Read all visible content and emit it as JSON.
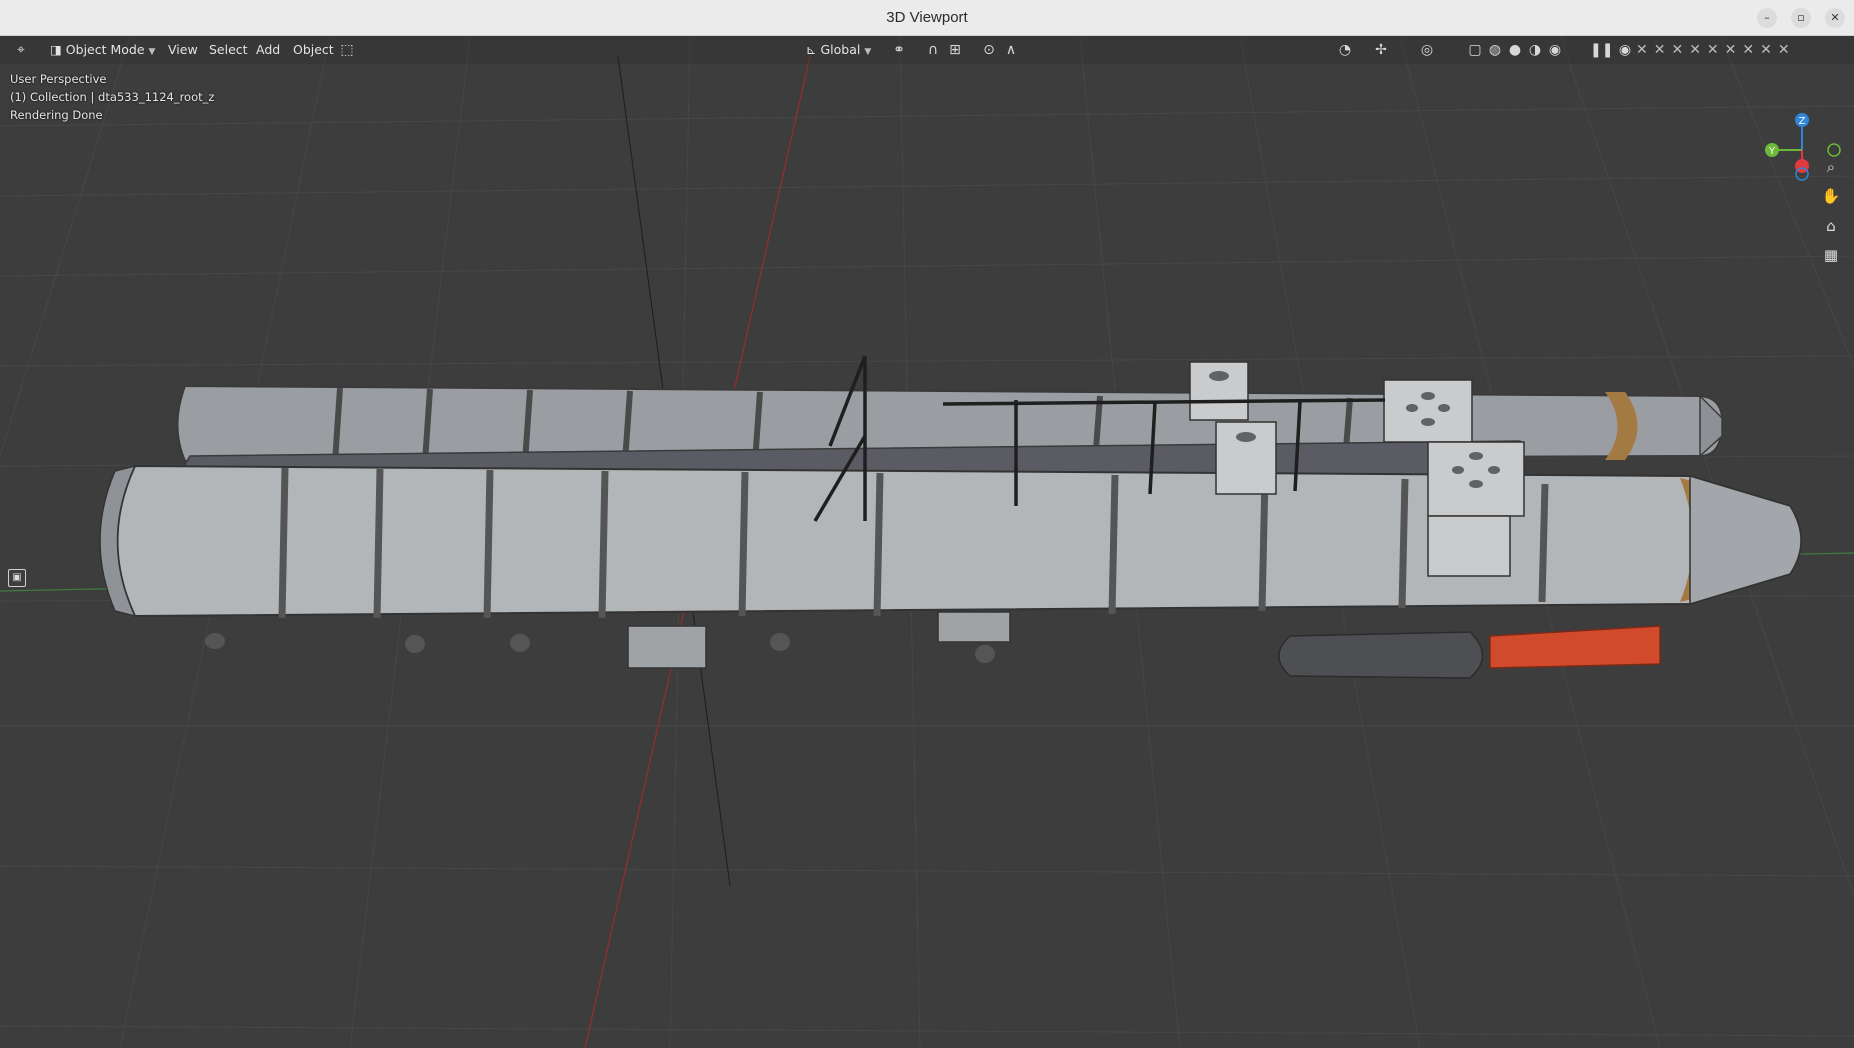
{
  "window": {
    "title": "3D Viewport",
    "controls": [
      "minimize-icon",
      "restore-icon",
      "close-icon"
    ]
  },
  "header": {
    "editor_type_icon": "editor-type-icon",
    "mode": "Object Mode",
    "menus": [
      "View",
      "Select",
      "Add",
      "Object"
    ],
    "transform_orientation": "Global",
    "icons": [
      "select-box-icon",
      "pivot-icon",
      "snap-icon",
      "snap-target-icon",
      "proportional-edit-icon",
      "falloff-icon",
      "visibility-icon",
      "gizmo-icon",
      "overlay-icon",
      "xray-icon",
      "wireframe-shading-icon",
      "solid-shading-icon",
      "material-shading-icon",
      "rendered-shading-icon",
      "pause-icon"
    ]
  },
  "overlay": {
    "perspective": "User Perspective",
    "collection": "(1) Collection | dta533_1124_root_z",
    "status": "Rendering Done"
  },
  "gizmo": {
    "z_label": "Z",
    "y_label": "Y",
    "colors": {
      "x": "#e0393e",
      "y": "#6cba3a",
      "z": "#2f86d6"
    }
  },
  "nav_buttons": [
    "zoom-icon",
    "pan-hand-icon",
    "camera-view-icon",
    "ortho-grid-icon"
  ],
  "colors": {
    "viewport_bg": "#3d3d3d",
    "grid": "#4a4a4a",
    "x_axis": "#9e2b2b",
    "y_axis": "#3d7a3d",
    "hull": "#a9acaf",
    "engine": "#d24a2c"
  }
}
